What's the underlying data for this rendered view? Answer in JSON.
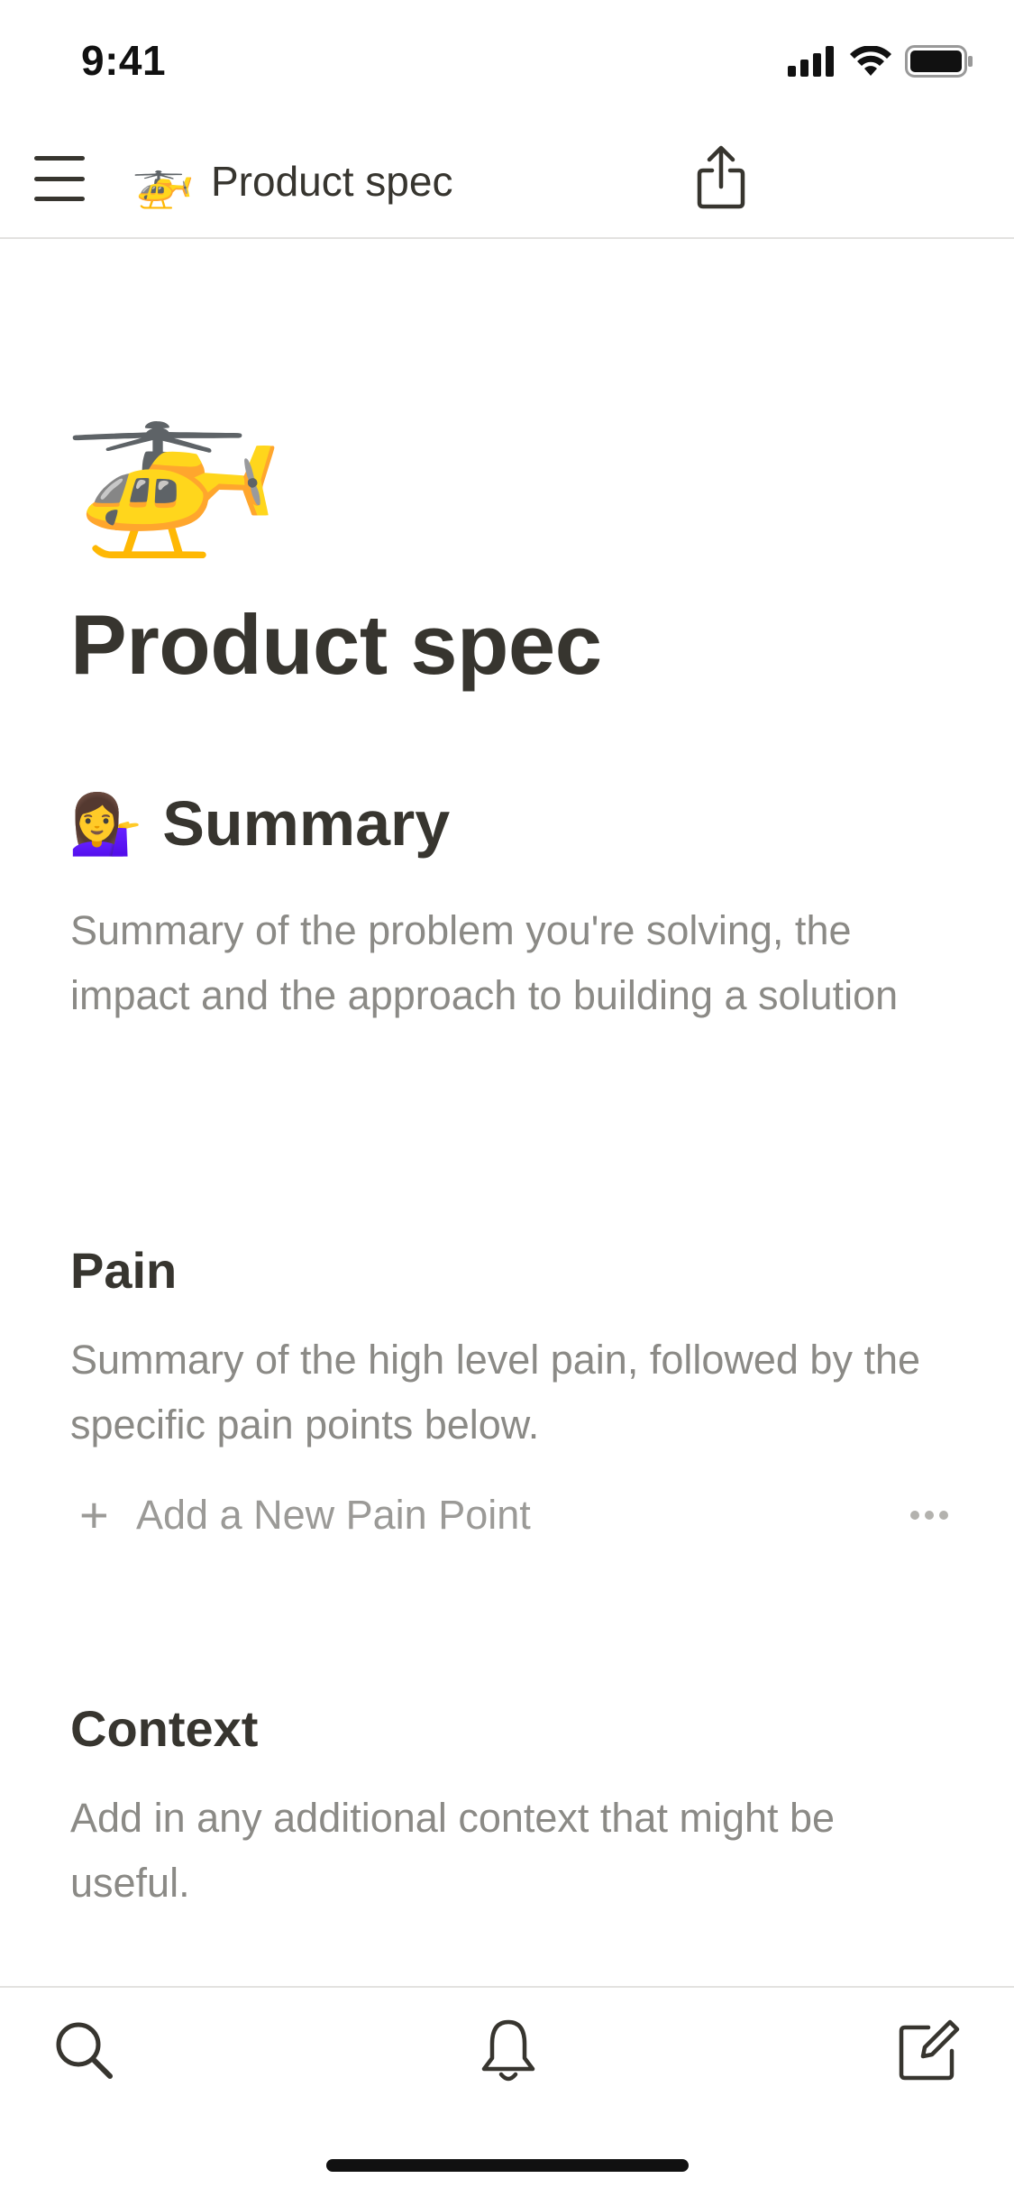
{
  "status_bar": {
    "time": "9:41",
    "icons": [
      "cellular-signal-icon",
      "wifi-icon",
      "battery-icon"
    ]
  },
  "nav": {
    "menu_icon": "hamburger-menu-icon",
    "page_icon": "🚁",
    "title": "Product spec",
    "share_icon": "share-icon"
  },
  "page": {
    "icon": "🚁",
    "title": "Product spec",
    "summary": {
      "emoji": "💁‍♀️",
      "heading": "Summary",
      "text": "Summary of the problem you're solving, the impact and the approach to building a solution"
    },
    "pain": {
      "heading": "Pain",
      "text": "Summary of the high level pain, followed by the specific pain points below.",
      "add_label": "Add a New Pain Point"
    },
    "context": {
      "heading": "Context",
      "text": "Add in any additional context that might be useful."
    }
  },
  "tab_bar": {
    "items": [
      "search-icon",
      "bell-icon",
      "compose-icon"
    ]
  },
  "colors": {
    "text_primary": "#37352f",
    "text_secondary": "#8b8a86",
    "divider": "#e3e2e0"
  }
}
